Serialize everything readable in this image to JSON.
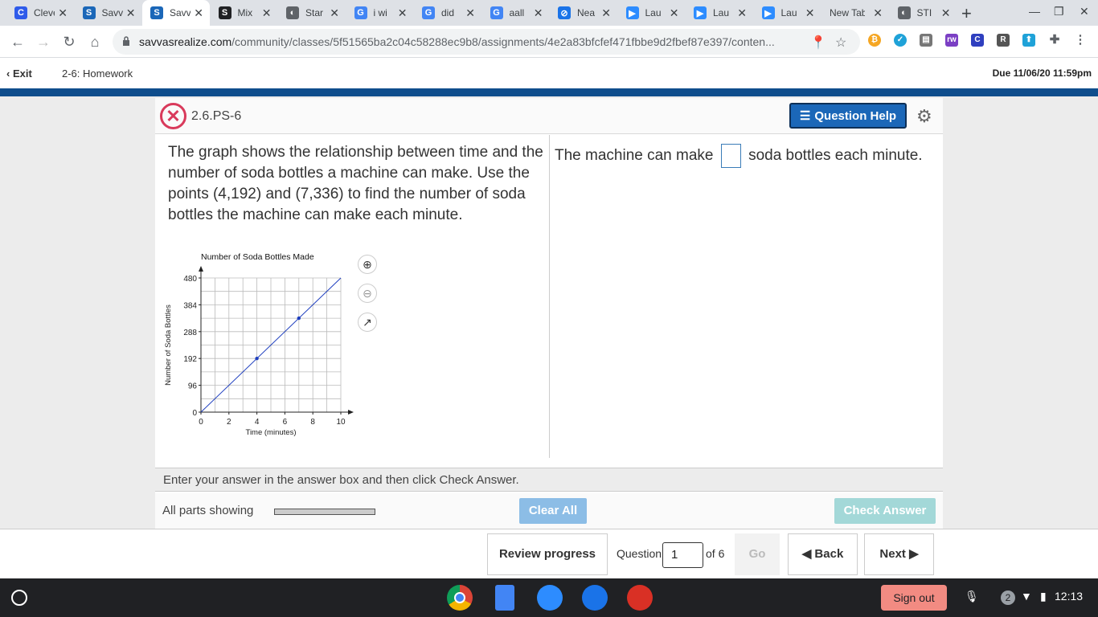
{
  "tabs": [
    {
      "label": "Clever",
      "icon": "C",
      "color": "#2f5bea"
    },
    {
      "label": "Savvas",
      "icon": "S",
      "color": "#1b67b8"
    },
    {
      "label": "Savvas",
      "icon": "S",
      "color": "#1b67b8",
      "active": true
    },
    {
      "label": "Mix",
      "icon": "S",
      "color": "#202124"
    },
    {
      "label": "Star",
      "icon": "◐",
      "color": "#5f6368"
    },
    {
      "label": "i wi",
      "icon": "G",
      "color": "#4285f4"
    },
    {
      "label": "did",
      "icon": "G",
      "color": "#4285f4"
    },
    {
      "label": "aall",
      "icon": "G",
      "color": "#4285f4"
    },
    {
      "label": "Nea",
      "icon": "⊘",
      "color": "#1a73e8"
    },
    {
      "label": "Lau",
      "icon": "▶",
      "color": "#2d8cff"
    },
    {
      "label": "Lau",
      "icon": "▶",
      "color": "#2d8cff"
    },
    {
      "label": "Lau",
      "icon": "▶",
      "color": "#2d8cff"
    },
    {
      "label": "New Tab",
      "icon": "",
      "color": ""
    },
    {
      "label": "STI",
      "icon": "◐",
      "color": "#5f6368"
    }
  ],
  "url": {
    "host": "savvasrealize.com",
    "path": "/community/classes/5f51565ba2c04c58288ec9b8/assignments/4e2a83bfcfef471fbbe9d2fbef87e397/conten..."
  },
  "header": {
    "exit_label": "Exit",
    "title": "2-6: Homework",
    "due": "Due 11/06/20 11:59pm"
  },
  "question": {
    "id": "2.6.PS-6",
    "help_label": "Question Help",
    "text": "The graph shows the relationship between time and the number of soda bottles a machine can make. Use the points (4,192) and (7,336) to find the number of soda bottles the machine can make each minute.",
    "answer_prefix": "The machine can make",
    "answer_suffix": "soda bottles each minute.",
    "instructions": "Enter your answer in the answer box and then click Check Answer.",
    "all_parts": "All parts showing",
    "clear_all": "Clear All",
    "check_answer": "Check Answer"
  },
  "chart_data": {
    "type": "line",
    "title": "Number of Soda Bottles Made",
    "xlabel": "Time (minutes)",
    "ylabel": "Number of Soda Bottles",
    "xlim": [
      0,
      10
    ],
    "ylim": [
      0,
      480
    ],
    "xticks": [
      0,
      2,
      4,
      6,
      8,
      10
    ],
    "yticks": [
      0,
      96,
      192,
      288,
      384,
      480
    ],
    "grid": true,
    "line": {
      "x": [
        0,
        10
      ],
      "y": [
        0,
        480
      ]
    },
    "points": [
      {
        "x": 4,
        "y": 192
      },
      {
        "x": 7,
        "y": 336
      }
    ],
    "line_color": "#1f3fbf"
  },
  "nav": {
    "review": "Review progress",
    "question_label": "Question",
    "question_value": "1",
    "of_label": "of 6",
    "go": "Go",
    "back": "Back",
    "next": "Next"
  },
  "shelf": {
    "sign_out": "Sign out",
    "notif_count": "2",
    "time": "12:13"
  }
}
